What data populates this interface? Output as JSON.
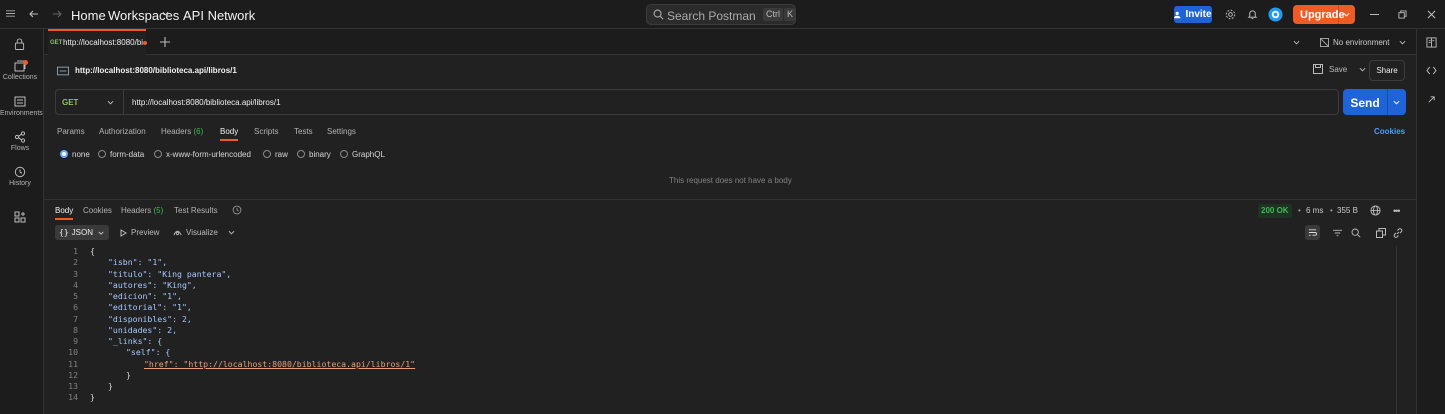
{
  "topbar": {
    "home": "Home",
    "workspaces": "Workspaces",
    "api_network": "API Network",
    "search_placeholder": "Search Postman",
    "kbd_ctrl": "Ctrl",
    "kbd_k": "K",
    "invite": "Invite",
    "upgrade": "Upgrade"
  },
  "sidebar": {
    "items": [
      {
        "label": "Collections",
        "icon": "collections-icon"
      },
      {
        "label": "Environments",
        "icon": "environments-icon"
      },
      {
        "label": "Flows",
        "icon": "flows-icon"
      },
      {
        "label": "History",
        "icon": "history-icon"
      }
    ]
  },
  "tabbar": {
    "tab_method": "GET",
    "tab_title": "http://localhost:8080/bi",
    "environment": "No environment"
  },
  "request": {
    "title": "http://localhost:8080/biblioteca.api/libros/1",
    "save": "Save",
    "share": "Share",
    "method": "GET",
    "url": "http://localhost:8080/biblioteca.api/libros/1",
    "send": "Send",
    "tabs": [
      "Params",
      "Authorization",
      "Headers",
      "Body",
      "Scripts",
      "Tests",
      "Settings"
    ],
    "headers_count": "(6)",
    "cookies": "Cookies",
    "body_types": [
      "none",
      "form-data",
      "x-www-form-urlencoded",
      "raw",
      "binary",
      "GraphQL"
    ],
    "no_body": "This request does not have a body"
  },
  "response": {
    "tabs": [
      "Body",
      "Cookies",
      "Headers",
      "Test Results"
    ],
    "headers_count": "(5)",
    "status": "200 OK",
    "time": "6 ms",
    "size": "355 B",
    "format": "JSON",
    "preview": "Preview",
    "visualize": "Visualize",
    "lines": [
      "{",
      "\"isbn\": \"1\",",
      "\"titulo\": \"King pantera\",",
      "\"autores\": \"King\",",
      "\"edicion\": \"1\",",
      "\"editorial\": \"1\",",
      "\"disponibles\": 2,",
      "\"unidades\": 2,",
      "\"_links\": {",
      "\"self\": {",
      "\"href\": \"http://localhost:8080/biblioteca.api/libros/1\"",
      "}",
      "}",
      "}"
    ]
  },
  "colors": {
    "accent_orange": "#ef5b25",
    "send_blue": "#1f64d6",
    "status_green": "#3fb950"
  }
}
